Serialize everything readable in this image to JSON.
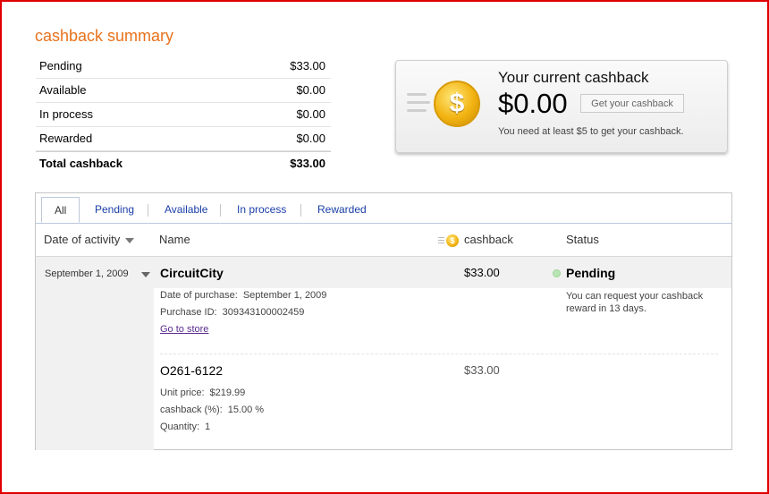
{
  "page": {
    "title": "cashback summary",
    "frame_color": "#e00000",
    "accent_color": "#e8721c"
  },
  "summary": {
    "rows": [
      {
        "label": "Pending",
        "value": "$33.00"
      },
      {
        "label": "Available",
        "value": "$0.00"
      },
      {
        "label": "In process",
        "value": "$0.00"
      },
      {
        "label": "Rewarded",
        "value": "$0.00"
      }
    ],
    "total": {
      "label": "Total cashback",
      "value": "$33.00"
    }
  },
  "current": {
    "title": "Your current cashback",
    "amount": "$0.00",
    "button_label": "Get your cashback",
    "note": "You need at least $5 to get your cashback.",
    "icon": "dollar-coin-icon"
  },
  "tabs": [
    "All",
    "Pending",
    "Available",
    "In process",
    "Rewarded"
  ],
  "active_tab": "All",
  "columns": {
    "date": "Date of activity",
    "name": "Name",
    "cashback": "cashback",
    "status": "Status"
  },
  "activity": {
    "date": "September 1, 2009",
    "store": "CircuitCity",
    "amount": "$33.00",
    "status": "Pending",
    "status_color": "#b7e6b4",
    "status_note": "You can request your cashback reward in 13 days.",
    "date_of_purchase_label": "Date of purchase:",
    "date_of_purchase": "September 1, 2009",
    "purchase_id_label": "Purchase ID:",
    "purchase_id": "309343100002459",
    "store_link": "Go to store",
    "item": {
      "name": "O261-6122",
      "amount": "$33.00",
      "unit_price_label": "Unit price:",
      "unit_price": "$219.99",
      "cashback_pct_label": "cashback (%):",
      "cashback_pct": "15.00 %",
      "quantity_label": "Quantity:",
      "quantity": "1"
    }
  }
}
